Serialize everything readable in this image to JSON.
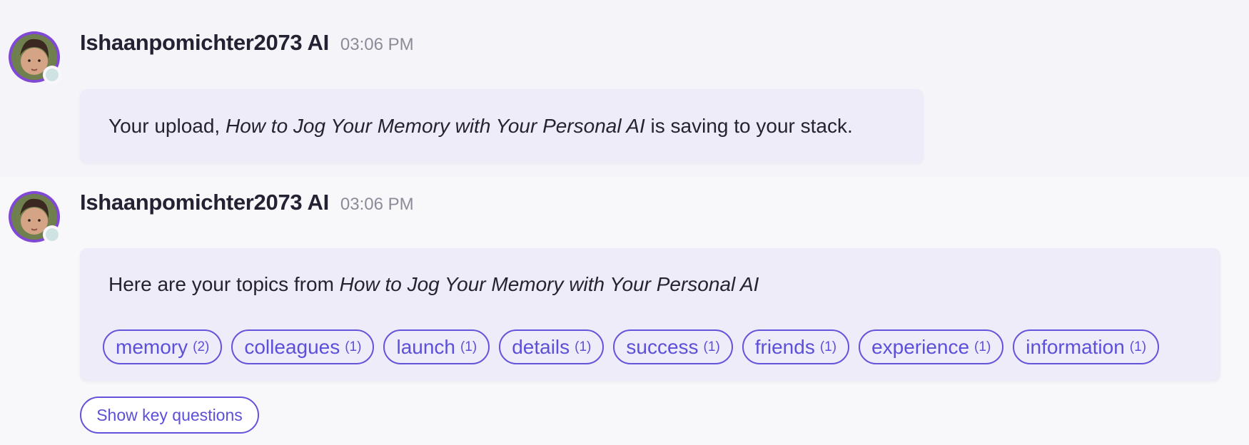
{
  "messages": [
    {
      "sender": "Ishaanpomichter2073 AI",
      "time": "03:06 PM",
      "text_prefix": "Your upload, ",
      "title": "How to Jog Your Memory with Your Personal AI",
      "text_suffix": " is saving to your stack."
    },
    {
      "sender": "Ishaanpomichter2073 AI",
      "time": "03:06 PM",
      "text_prefix": "Here are your topics from ",
      "title": "How to Jog Your Memory with Your Personal AI",
      "topics": [
        {
          "name": "memory",
          "count": "(2)"
        },
        {
          "name": "colleagues",
          "count": "(1)"
        },
        {
          "name": "launch",
          "count": "(1)"
        },
        {
          "name": "details",
          "count": "(1)"
        },
        {
          "name": "success",
          "count": "(1)"
        },
        {
          "name": "friends",
          "count": "(1)"
        },
        {
          "name": "experience",
          "count": "(1)"
        },
        {
          "name": "information",
          "count": "(1)"
        }
      ]
    }
  ],
  "actions": {
    "show_key_questions": "Show key questions"
  },
  "colors": {
    "accent": "#6453db",
    "avatar_ring": "#8147d6",
    "bubble_bg": "#efecfa",
    "status_dot": "#cfe3e4"
  }
}
